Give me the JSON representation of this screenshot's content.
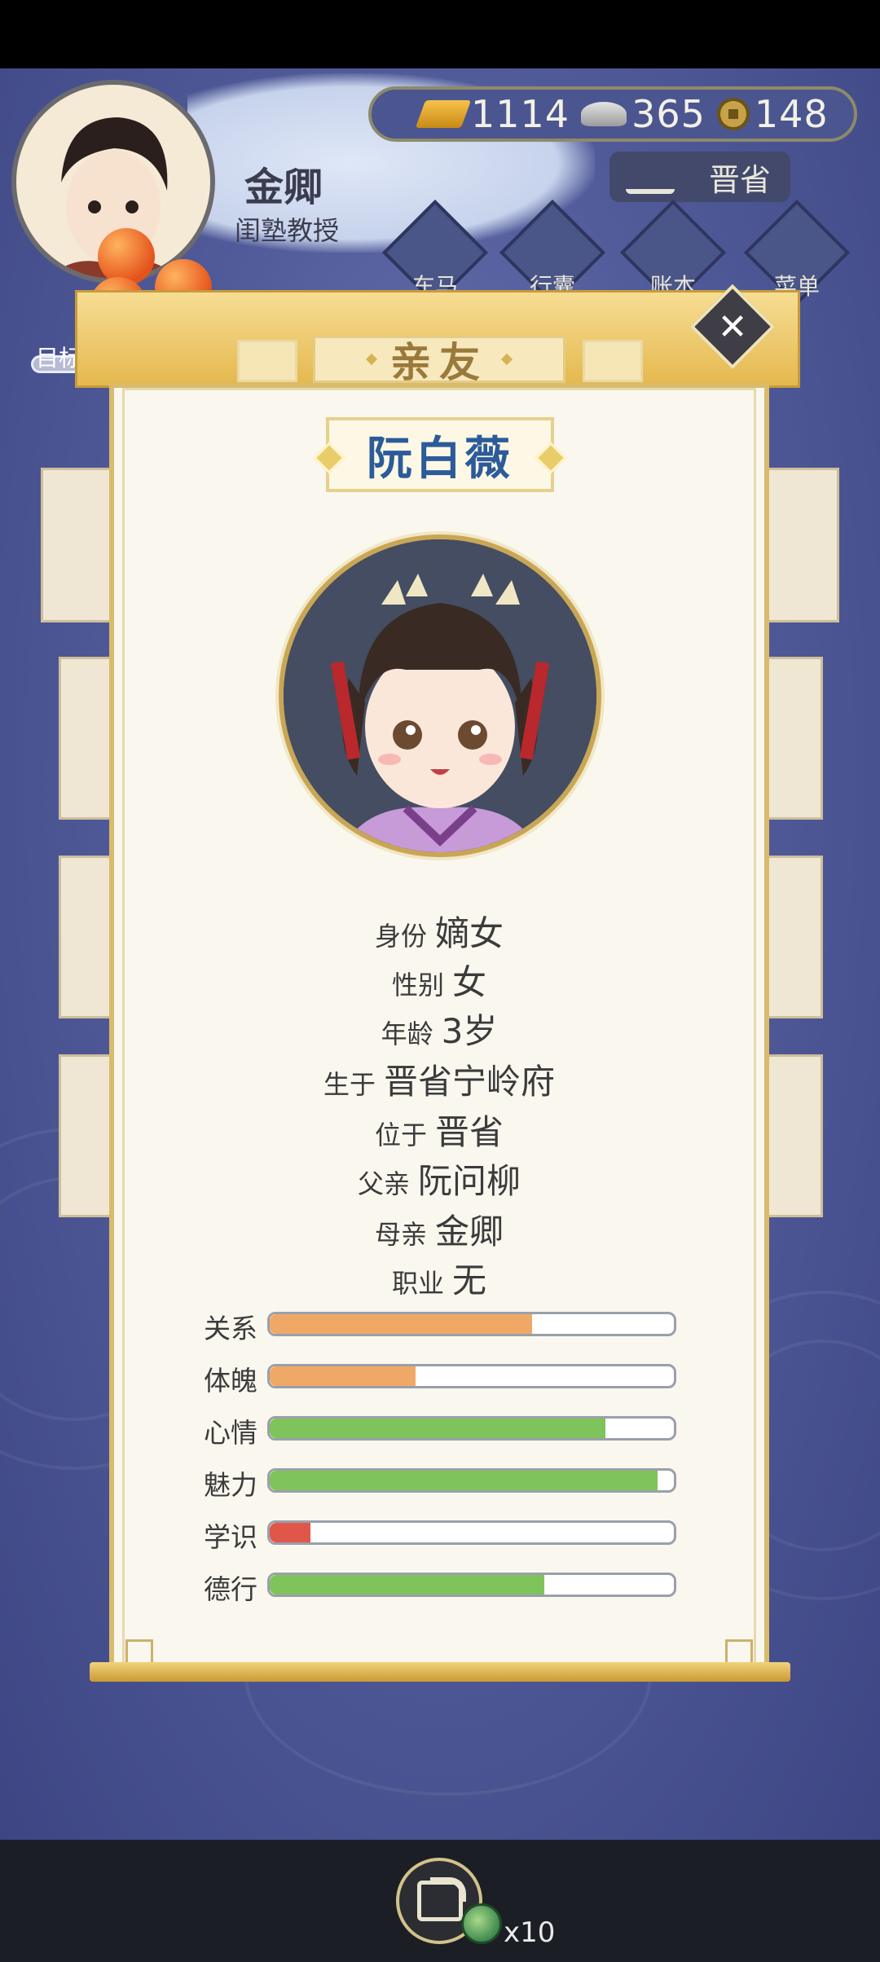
{
  "hud": {
    "player_name": "金卿",
    "player_title": "闺塾教授",
    "currency": {
      "gold": "1114",
      "silver": "365",
      "coins": "148"
    },
    "location": "晋省",
    "menu": [
      "车马",
      "行囊",
      "账本",
      "菜单"
    ],
    "goal_label": "目标"
  },
  "modal": {
    "title": "亲友",
    "character_name": "阮白薇",
    "info": [
      {
        "key": "身份",
        "value": "嫡女"
      },
      {
        "key": "性别",
        "value": "女"
      },
      {
        "key": "年龄",
        "value": "3岁"
      },
      {
        "key": "生于",
        "value": "晋省宁岭府"
      },
      {
        "key": "位于",
        "value": "晋省"
      },
      {
        "key": "父亲",
        "value": "阮问柳"
      },
      {
        "key": "母亲",
        "value": "金卿"
      },
      {
        "key": "职业",
        "value": "无"
      }
    ],
    "stats": [
      {
        "label": "关系",
        "level": 0.65,
        "color": "#f0a866"
      },
      {
        "label": "体魄",
        "level": 0.36,
        "color": "#f0a866"
      },
      {
        "label": "心情",
        "level": 0.83,
        "color": "#7ec45a"
      },
      {
        "label": "魅力",
        "level": 0.96,
        "color": "#7ec45a"
      },
      {
        "label": "学识",
        "level": 0.1,
        "color": "#e0574a"
      },
      {
        "label": "德行",
        "level": 0.68,
        "color": "#7ec45a"
      }
    ]
  },
  "bottom": {
    "item_count": "x10"
  },
  "icons": [
    "gold-ingot-icon",
    "silver-ingot-icon",
    "copper-coin-icon",
    "location-icon",
    "close-icon",
    "share-icon",
    "turtle-icon"
  ]
}
